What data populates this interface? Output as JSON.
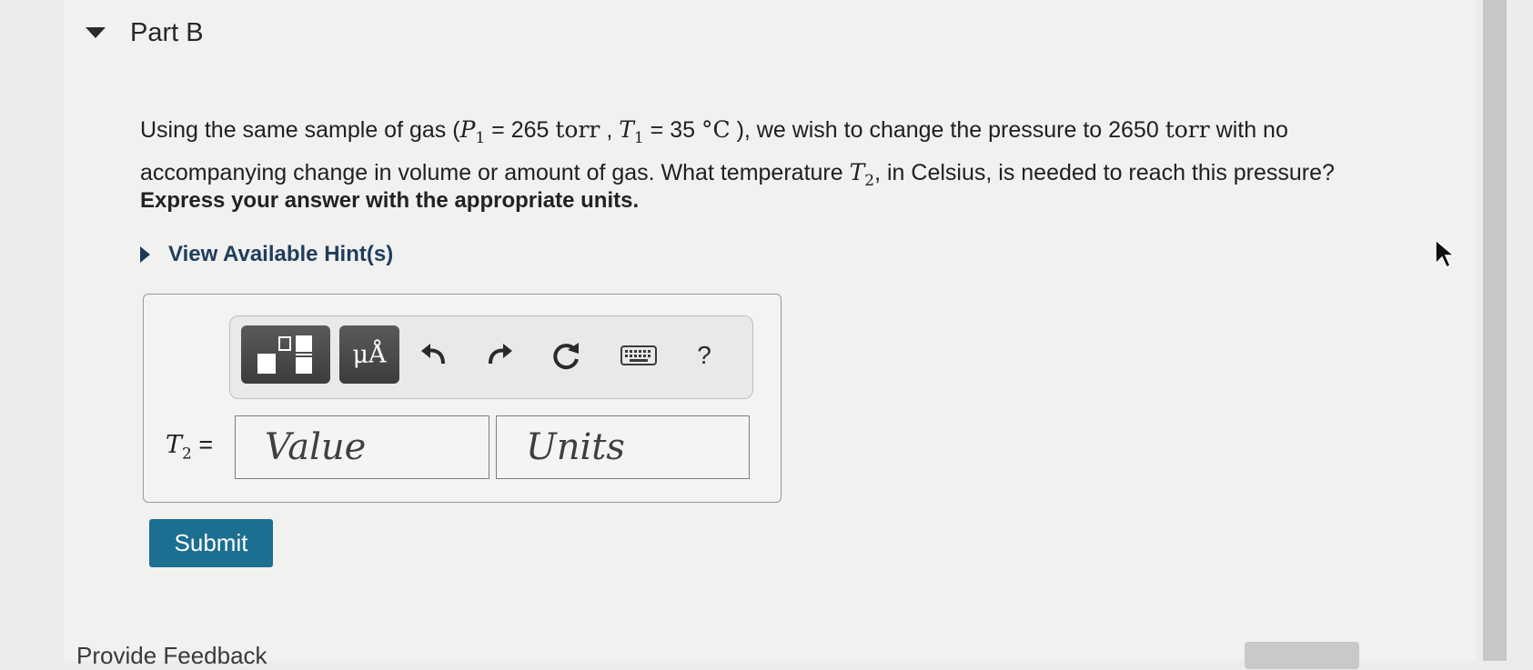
{
  "part": {
    "title": "Part B"
  },
  "question": {
    "t1": "Using the same sample of gas (",
    "p_var": "P",
    "p_sub": "1",
    "eq": " = 265 ",
    "torr": "torr",
    "sep": " , ",
    "t_var": "T",
    "t_sub": "1",
    "eq2": " = 35  ",
    "deg": "°C",
    "t2": " ), we wish to change the pressure to 2650 ",
    "torr2": "torr",
    "t3": " with no accompanying change in volume or amount of gas. What temperature ",
    "t2var": "T",
    "t2sub": "2",
    "t4": ", in Celsius, is needed to reach this pressure?"
  },
  "instruction": "Express your answer with the appropriate units.",
  "hint": {
    "label": "View Available Hint(s)"
  },
  "toolbar": {
    "templates_icon": "templates-icon",
    "units_label": "μÅ",
    "undo": "↶",
    "redo": "↷",
    "reset": "↻",
    "keyboard_icon": "keyboard-icon",
    "help": "?"
  },
  "answer": {
    "var": "T",
    "sub": "2",
    "eq": " =",
    "value_placeholder": "Value",
    "units_placeholder": "Units"
  },
  "submit_label": "Submit",
  "feedback_label": "Provide Feedback",
  "colors": {
    "submit": "#1d6f91",
    "hint": "#1f3d5c"
  }
}
